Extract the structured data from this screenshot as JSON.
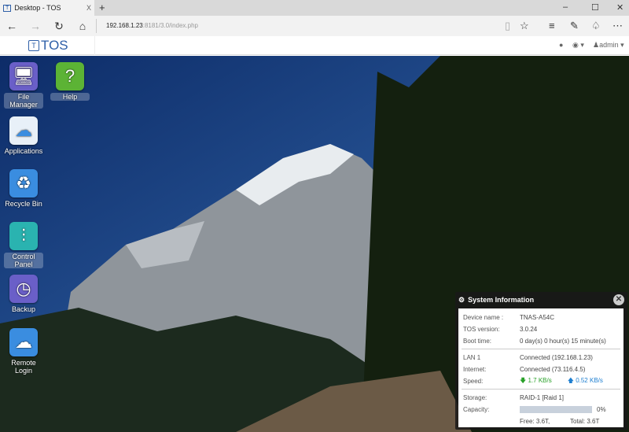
{
  "browser": {
    "tab_title": "Desktop - TOS",
    "tab_close": "X",
    "new_tab": "+",
    "url_host": "192.168.1.23",
    "url_rest": ":8181/3.0/index.php",
    "controls": {
      "minimize": "–",
      "maximize": "☐",
      "close": "✕"
    }
  },
  "app": {
    "logo": "TOS",
    "user": "admin"
  },
  "desktop_icons": [
    {
      "label": "File Manager",
      "color": "#6a5fc8"
    },
    {
      "label": "Help",
      "color": "#5cb335"
    },
    {
      "label": "Applications",
      "color": "#e8f0f8"
    },
    {
      "label": "Recycle Bin",
      "color": "#3a8de0"
    },
    {
      "label": "Control Panel",
      "color": "#2ab3b0"
    },
    {
      "label": "Backup",
      "color": "#6a5fc8"
    },
    {
      "label": "Remote Login",
      "color": "#3a8de0"
    }
  ],
  "system_info": {
    "title": "System Information",
    "device_name_label": "Device name :",
    "device_name": "TNAS-A54C",
    "tos_version_label": "TOS version:",
    "tos_version": "3.0.24",
    "boot_time_label": "Boot time:",
    "boot_time": "0 day(s) 0 hour(s) 15 minute(s)",
    "lan_label": "LAN 1",
    "lan": "Connected (192.168.1.23)",
    "internet_label": "Internet:",
    "internet": "Connected (73.116.4.5)",
    "speed_label": "Speed:",
    "download": "1.7 KB/s",
    "upload": "0.52 KB/s",
    "storage_label": "Storage:",
    "storage": "RAID-1 [Raid 1]",
    "capacity_label": "Capacity:",
    "capacity_percent": "0%",
    "capacity_fraction": 0,
    "free": "Free: 3.6T,",
    "total": "Total: 3.6T"
  }
}
